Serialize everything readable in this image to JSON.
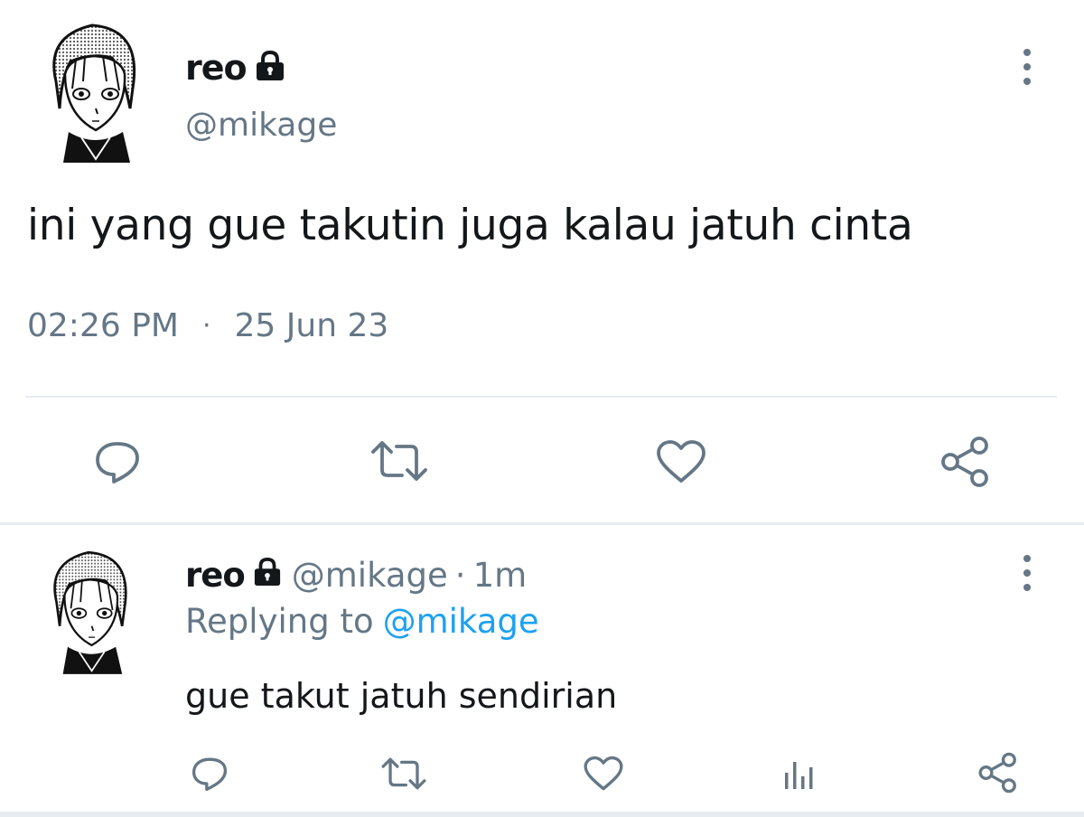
{
  "main_tweet": {
    "display_name": "reo",
    "handle": "@mikage",
    "text": "ini yang gue takutin juga kalau jatuh cinta",
    "time": "02:26 PM",
    "separator": "·",
    "date": "25 Jun 23",
    "avatar_icon": "manga-character-avatar",
    "lock_icon": "lock-icon",
    "more_icon": "vertical-ellipsis-icon",
    "actions": [
      "reply-icon",
      "retweet-icon",
      "like-icon",
      "share-icon"
    ]
  },
  "reply_tweet": {
    "display_name": "reo",
    "handle": "@mikage",
    "separator": "·",
    "time_ago": "1m",
    "replying_prefix": "Replying to",
    "replying_to": "@mikage",
    "text": "gue takut jatuh sendirian",
    "avatar_icon": "manga-character-avatar",
    "actions": [
      "reply-icon",
      "retweet-icon",
      "like-icon",
      "analytics-icon",
      "share-icon"
    ]
  },
  "colors": {
    "text_primary": "#14171a",
    "text_secondary": "#657786",
    "mention_blue": "#1da1f2",
    "icon_gray": "#657786",
    "divider": "#e6ecf0"
  }
}
